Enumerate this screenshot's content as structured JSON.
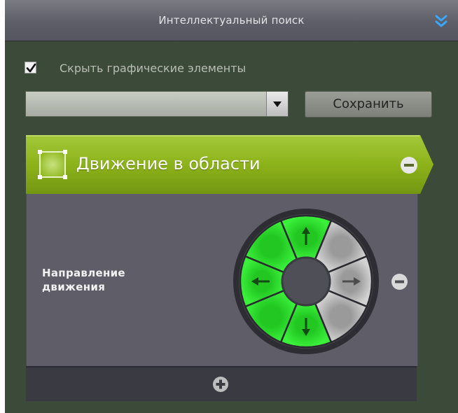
{
  "panel": {
    "title": "Интеллектуальный поиск",
    "collapse_icon": "double-chevron-down-icon"
  },
  "options": {
    "hide_graphics_label": "Скрыть графические элементы",
    "hide_graphics_checked": true
  },
  "preset": {
    "dropdown_value": "",
    "save_label": "Сохранить"
  },
  "condition": {
    "title": "Движение в области",
    "remove_icon": "minus-circle-icon",
    "accent_color": "#8fb516",
    "direction": {
      "label_line1": "Направление",
      "label_line2": "движения",
      "active_color": "#33e533",
      "inactive_color": "#bdbdbd",
      "selected": [
        "up",
        "up-left",
        "left",
        "down-left",
        "down"
      ],
      "unselected": [
        "up-right",
        "right",
        "down-right"
      ]
    },
    "add_icon": "plus-circle-icon"
  }
}
